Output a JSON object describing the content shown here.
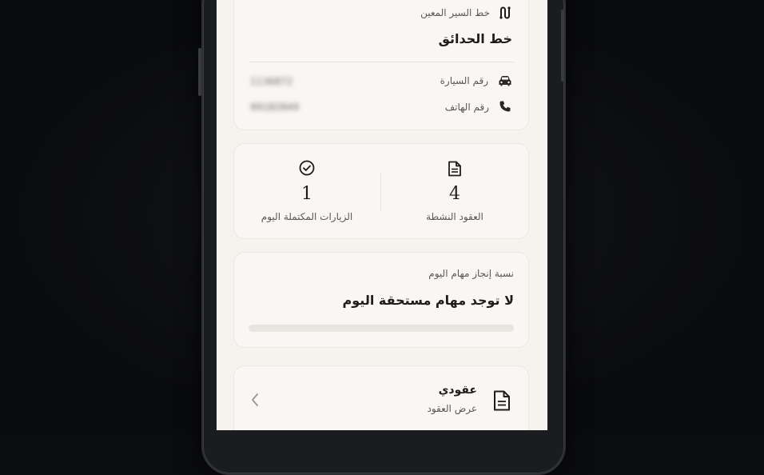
{
  "route": {
    "label": "خط السير المعين",
    "name": "خط الحدائق",
    "icon": "route-icon"
  },
  "vehicle": {
    "label": "رقم السيارة",
    "value": "1136872",
    "icon": "car-icon"
  },
  "phone": {
    "label": "رقم الهاتف",
    "value": "99182849",
    "icon": "phone-icon"
  },
  "stats": {
    "active_contracts": {
      "value": "4",
      "label": "العقود النشطة",
      "icon": "document-icon"
    },
    "completed_visits": {
      "value": "1",
      "label": "الزيارات المكتملة اليوم",
      "icon": "check-circle-icon"
    }
  },
  "tasks": {
    "label": "نسبة إنجاز مهام اليوم",
    "status": "لا توجد مهام مستحقة اليوم",
    "progress": 0
  },
  "contracts_link": {
    "title": "عقودي",
    "subtitle": "عرض العقود",
    "icon": "document-icon",
    "arrow_icon": "chevron-left-icon"
  },
  "colors": {
    "screen_bg": "#f6f3ef",
    "card_bg": "#f9f7f4",
    "text": "#1f1c1a",
    "muted": "#5b5753"
  }
}
